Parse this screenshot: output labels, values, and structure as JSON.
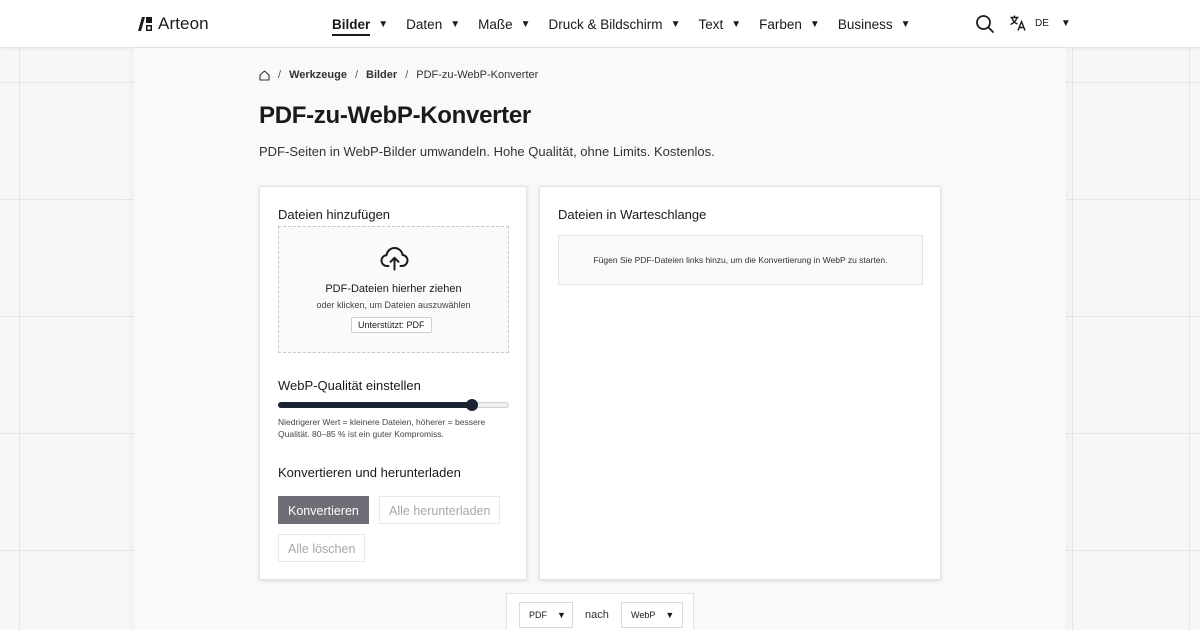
{
  "brand": {
    "name": "Arteon"
  },
  "nav": {
    "items": [
      {
        "label": "Bilder",
        "active": true
      },
      {
        "label": "Daten"
      },
      {
        "label": "Maße"
      },
      {
        "label": "Druck & Bildschirm"
      },
      {
        "label": "Text"
      },
      {
        "label": "Farben"
      },
      {
        "label": "Business"
      }
    ],
    "caret": "▼"
  },
  "header": {
    "search_icon": "search-icon",
    "language_icon": "translate-icon",
    "language_code": "DE"
  },
  "breadcrumb": {
    "home_icon": "home-icon",
    "separator": "/",
    "items": [
      "Werkzeuge",
      "Bilder",
      "PDF-zu-WebP-Konverter"
    ]
  },
  "page": {
    "title": "PDF-zu-WebP-Konverter",
    "subtitle": "PDF-Seiten in WebP-Bilder umwandeln. Hohe Qualität, ohne Limits. Kostenlos."
  },
  "upload": {
    "heading": "Dateien hinzufügen",
    "icon": "cloud-upload-icon",
    "title": "PDF-Dateien hierher ziehen",
    "hint": "oder klicken, um Dateien auszuwählen",
    "badge": "Unterstützt: PDF"
  },
  "quality": {
    "heading": "WebP-Qualität einstellen",
    "value_fraction": 0.84,
    "note": "Niedrigerer Wert = kleinere Dateien, höherer = bessere Qualität. 80–85 % ist ein guter Kompromiss."
  },
  "actions": {
    "heading": "Konvertieren und herunterladen",
    "convert": "Konvertieren",
    "download_all": "Alle herunterladen",
    "clear_all": "Alle löschen"
  },
  "queue": {
    "heading": "Dateien in Warteschlange",
    "empty_text": "Fügen Sie PDF-Dateien links hinzu, um die Konvertierung in WebP zu starten."
  },
  "format": {
    "from": "PDF",
    "separator": "nach",
    "to": "WebP"
  },
  "colors": {
    "accent": "#1a2233",
    "primary_button": "#6e6e76"
  }
}
